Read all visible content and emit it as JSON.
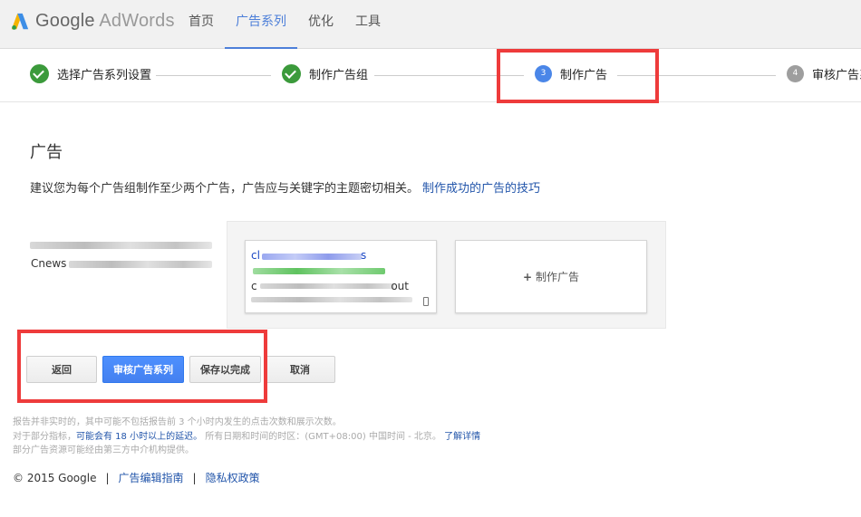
{
  "header": {
    "logo_google": "Google",
    "logo_product": "AdWords",
    "nav": [
      "首页",
      "广告系列",
      "优化",
      "工具"
    ],
    "active_nav": "广告系列"
  },
  "steps": [
    {
      "label": "选择广告系列设置",
      "state": "done"
    },
    {
      "label": "制作广告组",
      "state": "done"
    },
    {
      "number": "3",
      "label": "制作广告",
      "state": "current"
    },
    {
      "number": "4",
      "label": "审核广告系",
      "state": "pending"
    }
  ],
  "main": {
    "title": "广告",
    "description": "建议您为每个广告组制作至少两个广告，广告应与关键字的主题密切相关。",
    "tips_link": "制作成功的广告的技巧",
    "adgroup_label": "Cnews",
    "ad_preview": {
      "headline": "cl",
      "headline_end": "s",
      "line3_start": "c",
      "line3_end": "out"
    },
    "create_ad_label": "制作广告"
  },
  "buttons": {
    "back": "返回",
    "review": "审核广告系列",
    "save": "保存以完成",
    "cancel": "取消"
  },
  "notes": {
    "line1": "报告并非实时的，其中可能不包括报告前 3 个小时内发生的点击次数和展示次数。",
    "line2_prefix": "对于部分指标，",
    "line2_link": "可能会有 18 小时以上的延迟。",
    "line2_mid": "所有日期和时间的时区：(GMT+08:00) 中国时间 - 北京。",
    "line2_more": "了解详情",
    "line3": "部分广告资源可能经由第三方中介机构提供。"
  },
  "footer": {
    "copyright": "© 2015 Google",
    "link1": "广告编辑指南",
    "link2": "隐私权政策"
  },
  "colors": {
    "accent": "#4d7fd9",
    "done": "#3b9a3b",
    "highlight": "#ee3b3b",
    "primary_button": "#4d90fe"
  }
}
